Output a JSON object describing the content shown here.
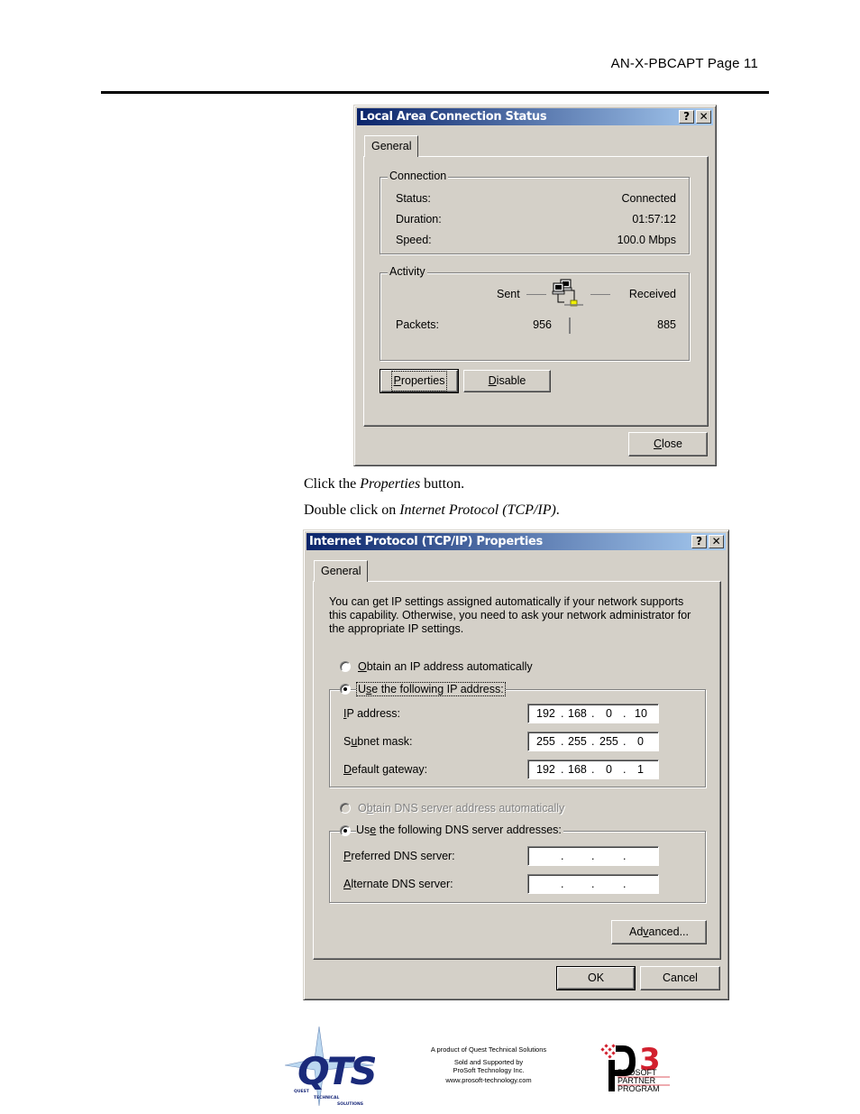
{
  "page": {
    "header": "AN-X-PBCAPT  Page 11",
    "instructions": [
      {
        "before": "Click the ",
        "emph": "Properties",
        "after": " button."
      },
      {
        "before": "Double click on ",
        "emph": "Internet Protocol (TCP/IP)",
        "after": "."
      }
    ]
  },
  "status_dialog": {
    "title": "Local Area Connection Status",
    "help_label": "?",
    "close_label": "✕",
    "tab": "General",
    "connection": {
      "group": "Connection",
      "rows": [
        {
          "label": "Status:",
          "value": "Connected"
        },
        {
          "label": "Duration:",
          "value": "01:57:12"
        },
        {
          "label": "Speed:",
          "value": "100.0 Mbps"
        }
      ]
    },
    "activity": {
      "group": "Activity",
      "sent_label": "Sent",
      "received_label": "Received",
      "packets_label": "Packets:",
      "packets_sent": "956",
      "packets_received": "885"
    },
    "buttons": {
      "properties": {
        "key": "P",
        "rest": "roperties"
      },
      "disable": {
        "key": "D",
        "rest": "isable"
      },
      "close": {
        "key": "C",
        "rest": "lose"
      }
    }
  },
  "tcpip_dialog": {
    "title": "Internet Protocol (TCP/IP) Properties",
    "help_label": "?",
    "close_label": "✕",
    "tab": "General",
    "intro_lines": [
      "You can get IP settings assigned automatically if your network supports",
      "this capability. Otherwise, you need to ask your network administrator for",
      "the appropriate IP settings."
    ],
    "ip_auto": {
      "pre": "",
      "key": "O",
      "rest": "btain an IP address automatically",
      "checked": false
    },
    "ip_manual": {
      "pre": "U",
      "key": "s",
      "rest": "e the following IP address:",
      "checked": true
    },
    "ip_fields": [
      {
        "pre": "",
        "key": "I",
        "rest": "P address:",
        "octets": [
          "192",
          "168",
          "0",
          "10"
        ]
      },
      {
        "pre": "S",
        "key": "u",
        "rest": "bnet mask:",
        "octets": [
          "255",
          "255",
          "255",
          "0"
        ]
      },
      {
        "pre": "",
        "key": "D",
        "rest": "efault gateway:",
        "octets": [
          "192",
          "168",
          "0",
          "1"
        ]
      }
    ],
    "dns_auto": {
      "pre": "O",
      "key": "b",
      "rest": "tain DNS server address automatically",
      "checked": false,
      "disabled": true
    },
    "dns_manual": {
      "pre": "Us",
      "key": "e",
      "rest": " the following DNS server addresses:",
      "checked": true
    },
    "dns_fields": [
      {
        "pre": "",
        "key": "P",
        "rest": "referred DNS server:",
        "octets": [
          "",
          "",
          "",
          ""
        ]
      },
      {
        "pre": "",
        "key": "A",
        "rest": "lternate DNS server:",
        "octets": [
          "",
          "",
          "",
          ""
        ]
      }
    ],
    "buttons": {
      "advanced": {
        "pre": "Ad",
        "key": "v",
        "rest": "anced..."
      },
      "ok": "OK",
      "cancel": "Cancel"
    }
  },
  "footer": {
    "qts_logo_letters": "QTS",
    "qts_tagline": [
      "QUEST",
      "TECHNICAL",
      "SOLUTIONS"
    ],
    "lines": [
      "A product of Quest Technical Solutions",
      "Sold and Supported by",
      "ProSoft Technology Inc.",
      "www.prosoft-technology.com"
    ],
    "p3_logo": {
      "mark": "P3",
      "lines": [
        "PROSOFT",
        "PARTNER",
        "PROGRAM"
      ]
    }
  },
  "colors": {
    "dialog_face": "#d4d0c8",
    "titlebar_start": "#0a246a",
    "titlebar_end": "#a6caf0",
    "qts_blue": "#1a2a7a",
    "p3_red": "#d2202e"
  }
}
